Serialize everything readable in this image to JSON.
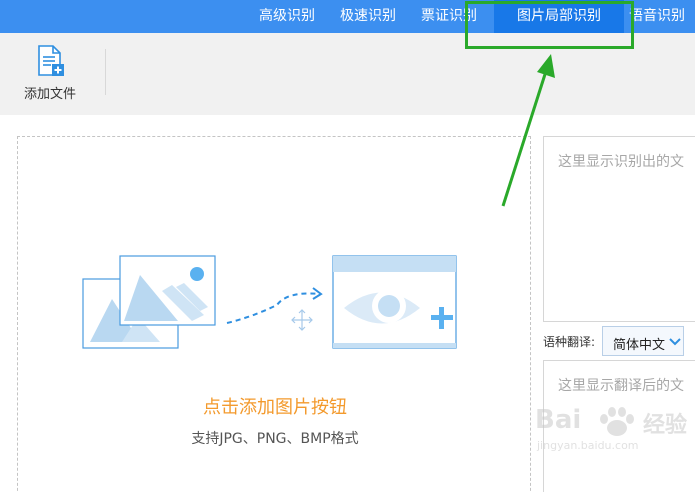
{
  "nav": {
    "tabs": [
      {
        "label": "高级识别"
      },
      {
        "label": "极速识别"
      },
      {
        "label": "票证识别"
      },
      {
        "label": "图片局部识别",
        "active": true
      },
      {
        "label": "语音识别"
      }
    ]
  },
  "toolbar": {
    "add_file_label": "添加文件",
    "add_file_icon": "add-file-icon"
  },
  "dropzone": {
    "title": "点击添加图片按钮",
    "subtitle": "支持JPG、PNG、BMP格式"
  },
  "result": {
    "placeholder": "这里显示识别出的文"
  },
  "translation": {
    "label": "语种翻译:",
    "selected": "简体中文",
    "placeholder": "这里显示翻译后的文"
  },
  "watermark": {
    "brand": "Bai",
    "brand2": "经验",
    "url": "jingyan.baidu.com"
  },
  "colors": {
    "nav_bg": "#3c8ff0",
    "nav_active": "#1878e8",
    "highlight": "#2aa92a",
    "accent_text": "#f39a2d",
    "icon_blue": "#2f8fe0"
  }
}
